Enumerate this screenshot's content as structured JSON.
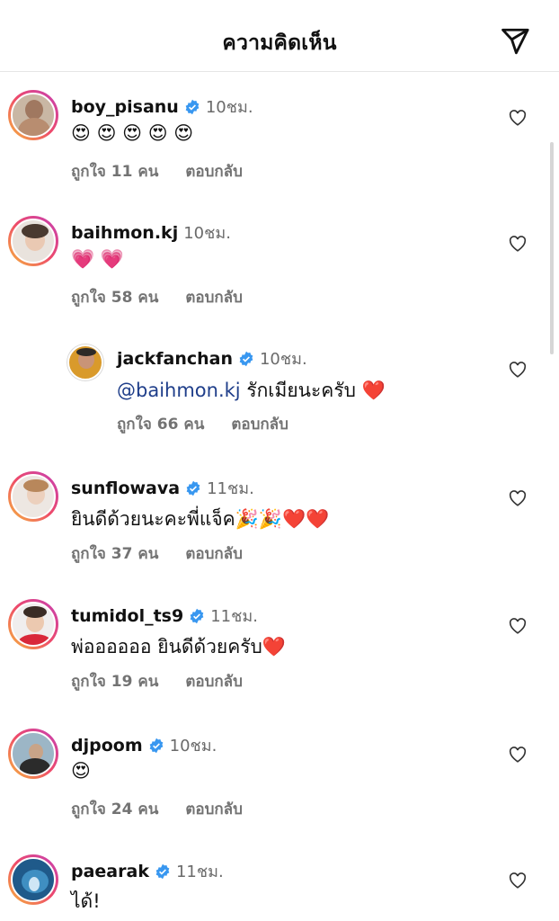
{
  "header": {
    "title": "ความคิดเห็น"
  },
  "comments": [
    {
      "username": "boy_pisanu",
      "verified": true,
      "time": "10ชม.",
      "text": "😍 😍 😍 😍 😍",
      "likes": "ถูกใจ 11 คน",
      "reply": "ตอบกลับ"
    },
    {
      "username": "baihmon.kj",
      "verified": false,
      "time": "10ชม.",
      "text": "💗 💗",
      "likes": "ถูกใจ 58 คน",
      "reply": "ตอบกลับ"
    },
    {
      "username": "jackfanchan",
      "verified": true,
      "time": "10ชม.",
      "mention": "@baihmon.kj",
      "text": " รักเมียนะครับ ❤️",
      "likes": "ถูกใจ 66 คน",
      "reply": "ตอบกลับ"
    },
    {
      "username": "sunflowava",
      "verified": true,
      "time": "11ชม.",
      "text": "ยินดีด้วยนะคะพี่แจ็ค🎉🎉❤️❤️",
      "likes": "ถูกใจ 37 คน",
      "reply": "ตอบกลับ"
    },
    {
      "username": "tumidol_ts9",
      "verified": true,
      "time": "11ชม.",
      "text": "พ่ออออออ ยินดีด้วยครับ❤️",
      "likes": "ถูกใจ 19 คน",
      "reply": "ตอบกลับ"
    },
    {
      "username": "djpoom",
      "verified": true,
      "time": "10ชม.",
      "text": "😍",
      "likes": "ถูกใจ 24 คน",
      "reply": "ตอบกลับ"
    },
    {
      "username": "paearak",
      "verified": true,
      "time": "11ชม.",
      "text": "ได้!"
    }
  ],
  "icons": {
    "send": "send-icon",
    "like": "heart-outline-icon",
    "verified": "verified-badge-icon"
  },
  "colors": {
    "verified": "#3897f0",
    "mention": "#1f3e8a",
    "meta": "#737373"
  }
}
